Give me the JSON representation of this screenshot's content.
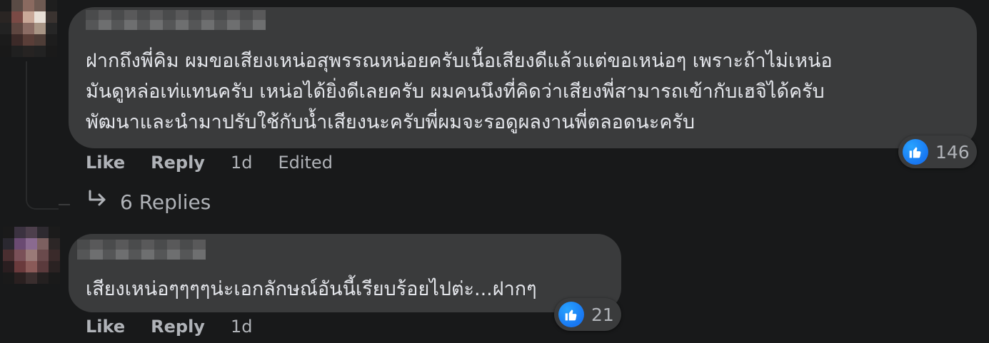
{
  "comments": [
    {
      "body": "ฝากถึงพี่คิม ผมขอเสียงเหน่อสุพรรณหน่อยครับเนื้อเสียงดีแล้วแต่ขอเหน่อๆ เพราะถ้าไม่เหน่อ\nมันดูหล่อเท่แทนครับ เหน่อได้ยิ่งดีเลยครับ ผมคนนึงที่คิดว่าเสียงพี่สามารถเข้ากับเฮจิได้ครับ\nพัฒนาและนำมาปรับใช้กับน้ำเสียงนะครับพี่ผมจะรอดูผลงานพี่ตลอดนะครับ",
      "reaction_icon": "like-icon",
      "reaction_count": "146",
      "like_label": "Like",
      "reply_label": "Reply",
      "time": "1d",
      "edited": "Edited",
      "replies_label": "6 Replies"
    },
    {
      "body": "เสียงเหน่อๆๆๆๆน่ะเอกลักษณ์อันนี้เรียบร้อยไปต่ะ...ฝากๆ",
      "reaction_icon": "like-icon",
      "reaction_count": "21",
      "like_label": "Like",
      "reply_label": "Reply",
      "time": "1d"
    }
  ],
  "colors": {
    "background": "#18191a",
    "bubble": "#3a3b3c",
    "text": "#e4e6eb",
    "secondary_text": "#b0b3b8",
    "like_blue": "#1877f2"
  }
}
